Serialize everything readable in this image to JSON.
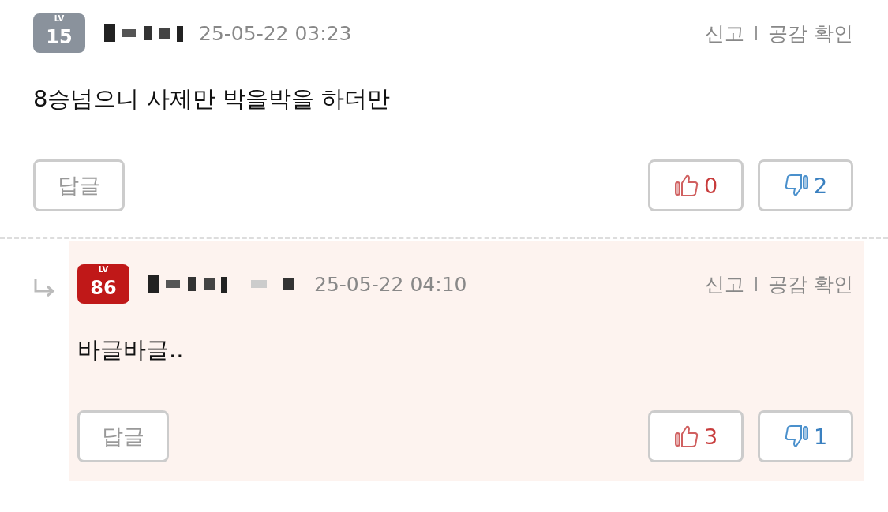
{
  "comments": [
    {
      "kind": "comment",
      "badge": {
        "label": "LV",
        "level": "15",
        "color": "#8a929c"
      },
      "date": "25-05-22 03:23",
      "actions": [
        "신고",
        "공감 확인"
      ],
      "body": "8승넘으니 사제만 박을박을 하더만",
      "reply_button": "답글",
      "likes": "0",
      "dislikes": "2"
    },
    {
      "kind": "reply",
      "badge": {
        "label": "LV",
        "level": "86",
        "color": "#c01818"
      },
      "date": "25-05-22 04:10",
      "actions": [
        "신고",
        "공감 확인"
      ],
      "body": "바글바글..",
      "reply_button": "답글",
      "likes": "3",
      "dislikes": "1"
    }
  ]
}
